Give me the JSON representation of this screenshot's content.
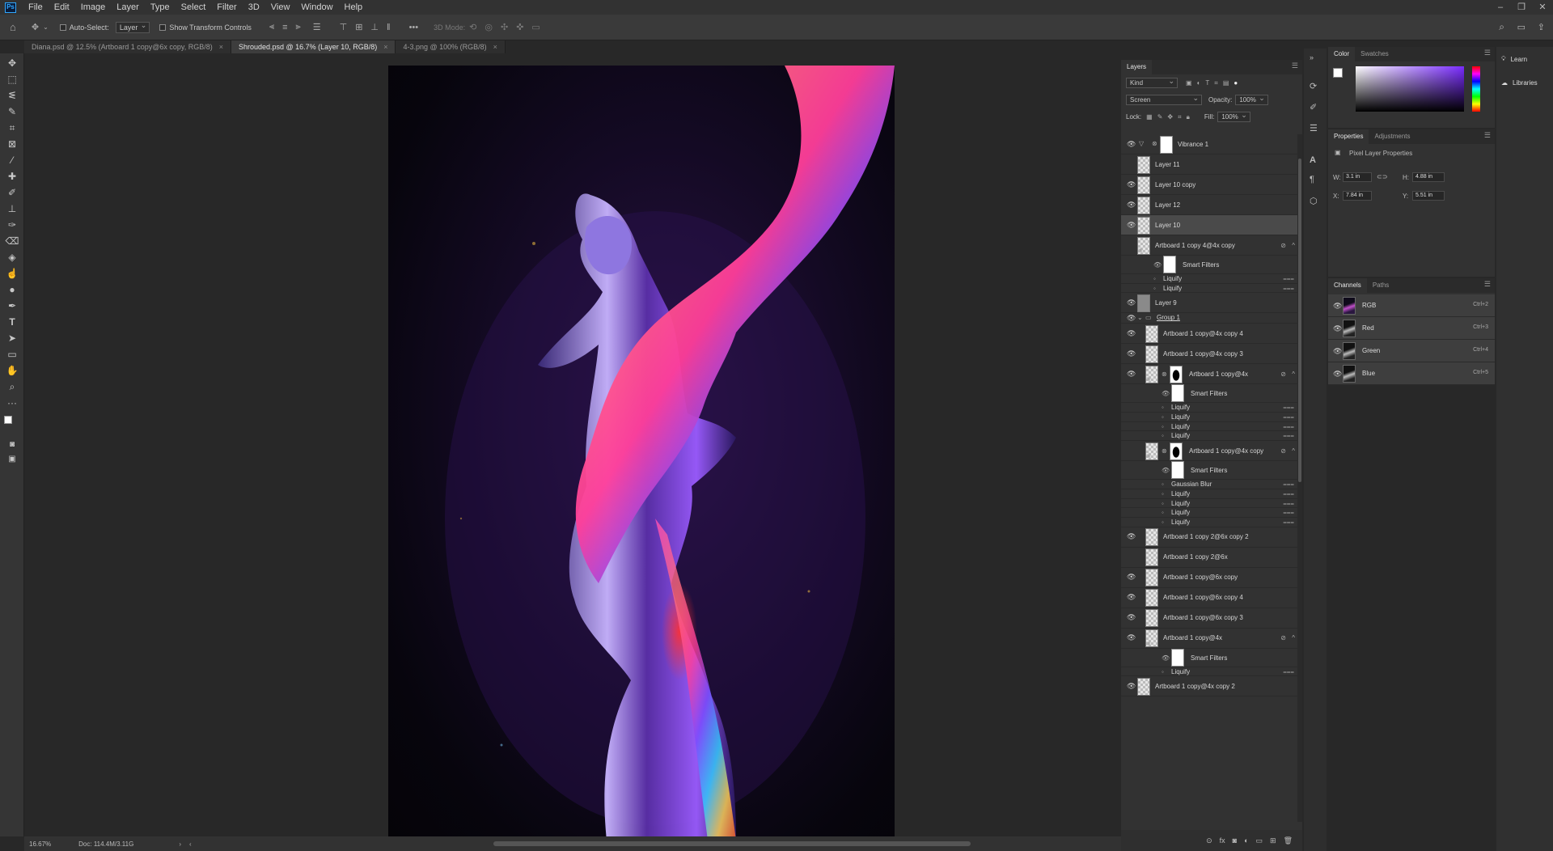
{
  "app": {
    "menu": [
      "File",
      "Edit",
      "Image",
      "Layer",
      "Type",
      "Select",
      "Filter",
      "3D",
      "View",
      "Window",
      "Help"
    ],
    "window_controls": [
      "–",
      "❐",
      "✕"
    ]
  },
  "options_bar": {
    "auto_select_label": "Auto-Select:",
    "auto_select_value": "Layer",
    "transform_label": "Show Transform Controls",
    "mode_label": "3D Mode:"
  },
  "tabs": [
    {
      "label": "Diana.psd @ 12.5% (Artboard 1 copy@6x copy, RGB/8)",
      "active": false
    },
    {
      "label": "Shrouded.psd @ 16.7% (Layer 10, RGB/8)",
      "active": true
    },
    {
      "label": "4-3.png @ 100% (RGB/8)",
      "active": false
    }
  ],
  "status": {
    "zoom": "16.67%",
    "doc": "Doc: 114.4M/3.11G"
  },
  "layers": {
    "panel_title": "Layers",
    "kind_filter": "Kind",
    "blend_mode": "Screen",
    "opacity_label": "Opacity:",
    "opacity_value": "100%",
    "lock_label": "Lock:",
    "fill_label": "Fill:",
    "fill_value": "100%",
    "rows": [
      {
        "type": "layer",
        "name": "Vibrance 1",
        "eye": true,
        "thumb": "white",
        "adjustment": true
      },
      {
        "type": "layer",
        "name": "Layer 11",
        "eye": false,
        "thumb": "checker"
      },
      {
        "type": "layer",
        "name": "Layer 10 copy",
        "eye": true,
        "thumb": "checker"
      },
      {
        "type": "layer",
        "name": "Layer 12",
        "eye": true,
        "thumb": "checker"
      },
      {
        "type": "layer",
        "name": "Layer 10",
        "eye": true,
        "thumb": "checker",
        "selected": true
      },
      {
        "type": "layer",
        "name": "Artboard 1 copy 4@4x copy",
        "eye": false,
        "thumb": "checker",
        "smart": true
      },
      {
        "type": "sf-header",
        "name": "Smart Filters",
        "indent": 1
      },
      {
        "type": "filter",
        "name": "Liquify",
        "indent": 1
      },
      {
        "type": "filter",
        "name": "Liquify",
        "indent": 1
      },
      {
        "type": "layer",
        "name": "Layer 9",
        "eye": true,
        "thumb": "grey"
      },
      {
        "type": "group",
        "name": "Group 1",
        "eye": true
      },
      {
        "type": "layer",
        "name": "Artboard 1 copy@4x copy 4",
        "eye": true,
        "thumb": "checker",
        "indent": 1
      },
      {
        "type": "layer",
        "name": "Artboard 1 copy@4x copy 3",
        "eye": true,
        "thumb": "checker",
        "indent": 1
      },
      {
        "type": "layer",
        "name": "Artboard 1 copy@4x",
        "eye": true,
        "thumb": "checker",
        "indent": 1,
        "mask": true,
        "smart": true
      },
      {
        "type": "sf-header",
        "name": "Smart Filters",
        "indent": 2
      },
      {
        "type": "filter",
        "name": "Liquify",
        "indent": 2
      },
      {
        "type": "filter",
        "name": "Liquify",
        "indent": 2
      },
      {
        "type": "filter",
        "name": "Liquify",
        "indent": 2
      },
      {
        "type": "filter",
        "name": "Liquify",
        "indent": 2
      },
      {
        "type": "layer",
        "name": "Artboard 1 copy@4x copy",
        "eye": false,
        "thumb": "checker",
        "indent": 1,
        "mask": true,
        "smart": true
      },
      {
        "type": "sf-header",
        "name": "Smart Filters",
        "indent": 2
      },
      {
        "type": "filter",
        "name": "Gaussian Blur",
        "indent": 2
      },
      {
        "type": "filter",
        "name": "Liquify",
        "indent": 2
      },
      {
        "type": "filter",
        "name": "Liquify",
        "indent": 2
      },
      {
        "type": "filter",
        "name": "Liquify",
        "indent": 2
      },
      {
        "type": "filter",
        "name": "Liquify",
        "indent": 2
      },
      {
        "type": "layer",
        "name": "Artboard 1 copy 2@6x copy 2",
        "eye": true,
        "thumb": "checker",
        "indent": 1
      },
      {
        "type": "layer",
        "name": "Artboard 1 copy 2@6x",
        "eye": false,
        "thumb": "checker",
        "indent": 1
      },
      {
        "type": "layer",
        "name": "Artboard 1 copy@6x copy",
        "eye": true,
        "thumb": "checker",
        "indent": 1
      },
      {
        "type": "layer",
        "name": "Artboard 1 copy@6x copy 4",
        "eye": true,
        "thumb": "checker",
        "indent": 1
      },
      {
        "type": "layer",
        "name": "Artboard 1 copy@6x copy 3",
        "eye": true,
        "thumb": "checker",
        "indent": 1
      },
      {
        "type": "layer",
        "name": "Artboard 1 copy@4x",
        "eye": true,
        "thumb": "checker",
        "indent": 1,
        "smart": true
      },
      {
        "type": "sf-header",
        "name": "Smart Filters",
        "indent": 2
      },
      {
        "type": "filter",
        "name": "Liquify",
        "indent": 2
      },
      {
        "type": "layer",
        "name": "Artboard 1 copy@4x copy 2",
        "eye": true,
        "thumb": "checker"
      }
    ]
  },
  "color_panel": {
    "tabs": [
      "Color",
      "Swatches"
    ]
  },
  "properties_panel": {
    "tabs": [
      "Properties",
      "Adjustments"
    ],
    "section": "Pixel Layer Properties",
    "w_label": "W:",
    "w_value": "3.1 in",
    "h_label": "H:",
    "h_value": "4.88 in",
    "x_label": "X:",
    "x_value": "7.84 in",
    "y_label": "Y:",
    "y_value": "5.51 in"
  },
  "channels_panel": {
    "tabs": [
      "Channels",
      "Paths"
    ],
    "rows": [
      {
        "name": "RGB",
        "shortcut": "Ctrl+2"
      },
      {
        "name": "Red",
        "shortcut": "Ctrl+3"
      },
      {
        "name": "Green",
        "shortcut": "Ctrl+4"
      },
      {
        "name": "Blue",
        "shortcut": "Ctrl+5"
      }
    ]
  },
  "right_dock": {
    "learn": "Learn",
    "libraries": "Libraries"
  },
  "colors": {
    "accent": "#31a8ff",
    "panel_bg": "#323232",
    "canvas_bg": "#282828"
  }
}
